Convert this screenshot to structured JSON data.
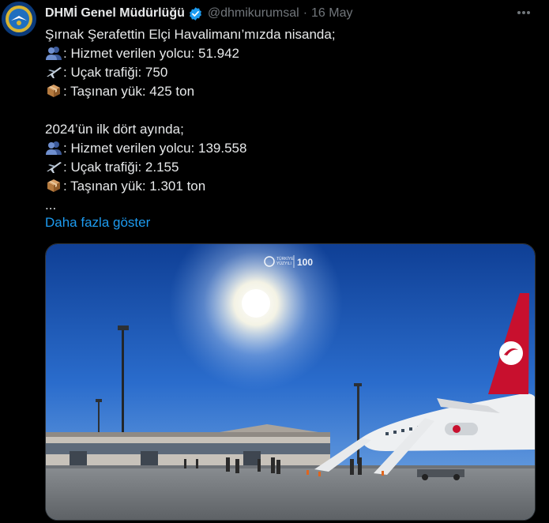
{
  "author": {
    "name": "DHMİ Genel Müdürlüğü",
    "handle": "@dhmikurumsal",
    "separator": "·",
    "date": "16 May"
  },
  "post": {
    "intro": "Şırnak Şerafettin Elçi Havalimanı’mızda nisanda;",
    "april": {
      "passengers": ": Hizmet verilen yolcu: 51.942",
      "flights": ": Uçak trafiği: 750",
      "cargo": ": Taşınan yük: 425 ton"
    },
    "period_heading": "2024’ün ilk dört ayında;",
    "period": {
      "passengers": ": Hizmet verilen yolcu: 139.558",
      "flights": ": Uçak trafiği: 2.155",
      "cargo": ": Taşınan yük: 1.301 ton"
    },
    "ellipsis": "...",
    "show_more": "Daha fazla göster"
  },
  "media": {
    "description": "photo",
    "watermark_left": "TÜRKİYE YÜZYILI",
    "watermark_right": "100"
  },
  "icons": {
    "passengers": "busts-in-silhouette-icon",
    "flights": "airplane-icon",
    "cargo": "package-icon",
    "verified": "verified-badge-icon",
    "more": "more-options-icon"
  },
  "colors": {
    "link": "#1d9bf0",
    "secondary": "#71767b",
    "verified": "#1d9bf0"
  }
}
